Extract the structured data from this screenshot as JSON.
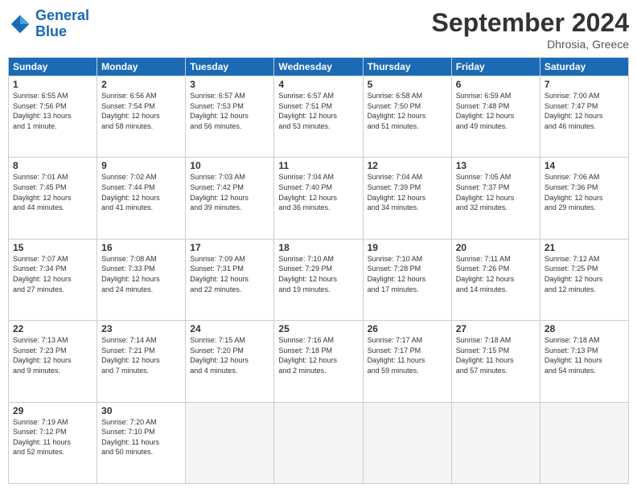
{
  "header": {
    "logo_line1": "General",
    "logo_line2": "Blue",
    "title": "September 2024",
    "location": "Dhrosia, Greece"
  },
  "weekdays": [
    "Sunday",
    "Monday",
    "Tuesday",
    "Wednesday",
    "Thursday",
    "Friday",
    "Saturday"
  ],
  "weeks": [
    [
      {
        "day": "1",
        "info": "Sunrise: 6:55 AM\nSunset: 7:56 PM\nDaylight: 13 hours\nand 1 minute."
      },
      {
        "day": "2",
        "info": "Sunrise: 6:56 AM\nSunset: 7:54 PM\nDaylight: 12 hours\nand 58 minutes."
      },
      {
        "day": "3",
        "info": "Sunrise: 6:57 AM\nSunset: 7:53 PM\nDaylight: 12 hours\nand 56 minutes."
      },
      {
        "day": "4",
        "info": "Sunrise: 6:57 AM\nSunset: 7:51 PM\nDaylight: 12 hours\nand 53 minutes."
      },
      {
        "day": "5",
        "info": "Sunrise: 6:58 AM\nSunset: 7:50 PM\nDaylight: 12 hours\nand 51 minutes."
      },
      {
        "day": "6",
        "info": "Sunrise: 6:59 AM\nSunset: 7:48 PM\nDaylight: 12 hours\nand 49 minutes."
      },
      {
        "day": "7",
        "info": "Sunrise: 7:00 AM\nSunset: 7:47 PM\nDaylight: 12 hours\nand 46 minutes."
      }
    ],
    [
      {
        "day": "8",
        "info": "Sunrise: 7:01 AM\nSunset: 7:45 PM\nDaylight: 12 hours\nand 44 minutes."
      },
      {
        "day": "9",
        "info": "Sunrise: 7:02 AM\nSunset: 7:44 PM\nDaylight: 12 hours\nand 41 minutes."
      },
      {
        "day": "10",
        "info": "Sunrise: 7:03 AM\nSunset: 7:42 PM\nDaylight: 12 hours\nand 39 minutes."
      },
      {
        "day": "11",
        "info": "Sunrise: 7:04 AM\nSunset: 7:40 PM\nDaylight: 12 hours\nand 36 minutes."
      },
      {
        "day": "12",
        "info": "Sunrise: 7:04 AM\nSunset: 7:39 PM\nDaylight: 12 hours\nand 34 minutes."
      },
      {
        "day": "13",
        "info": "Sunrise: 7:05 AM\nSunset: 7:37 PM\nDaylight: 12 hours\nand 32 minutes."
      },
      {
        "day": "14",
        "info": "Sunrise: 7:06 AM\nSunset: 7:36 PM\nDaylight: 12 hours\nand 29 minutes."
      }
    ],
    [
      {
        "day": "15",
        "info": "Sunrise: 7:07 AM\nSunset: 7:34 PM\nDaylight: 12 hours\nand 27 minutes."
      },
      {
        "day": "16",
        "info": "Sunrise: 7:08 AM\nSunset: 7:33 PM\nDaylight: 12 hours\nand 24 minutes."
      },
      {
        "day": "17",
        "info": "Sunrise: 7:09 AM\nSunset: 7:31 PM\nDaylight: 12 hours\nand 22 minutes."
      },
      {
        "day": "18",
        "info": "Sunrise: 7:10 AM\nSunset: 7:29 PM\nDaylight: 12 hours\nand 19 minutes."
      },
      {
        "day": "19",
        "info": "Sunrise: 7:10 AM\nSunset: 7:28 PM\nDaylight: 12 hours\nand 17 minutes."
      },
      {
        "day": "20",
        "info": "Sunrise: 7:11 AM\nSunset: 7:26 PM\nDaylight: 12 hours\nand 14 minutes."
      },
      {
        "day": "21",
        "info": "Sunrise: 7:12 AM\nSunset: 7:25 PM\nDaylight: 12 hours\nand 12 minutes."
      }
    ],
    [
      {
        "day": "22",
        "info": "Sunrise: 7:13 AM\nSunset: 7:23 PM\nDaylight: 12 hours\nand 9 minutes."
      },
      {
        "day": "23",
        "info": "Sunrise: 7:14 AM\nSunset: 7:21 PM\nDaylight: 12 hours\nand 7 minutes."
      },
      {
        "day": "24",
        "info": "Sunrise: 7:15 AM\nSunset: 7:20 PM\nDaylight: 12 hours\nand 4 minutes."
      },
      {
        "day": "25",
        "info": "Sunrise: 7:16 AM\nSunset: 7:18 PM\nDaylight: 12 hours\nand 2 minutes."
      },
      {
        "day": "26",
        "info": "Sunrise: 7:17 AM\nSunset: 7:17 PM\nDaylight: 11 hours\nand 59 minutes."
      },
      {
        "day": "27",
        "info": "Sunrise: 7:18 AM\nSunset: 7:15 PM\nDaylight: 11 hours\nand 57 minutes."
      },
      {
        "day": "28",
        "info": "Sunrise: 7:18 AM\nSunset: 7:13 PM\nDaylight: 11 hours\nand 54 minutes."
      }
    ],
    [
      {
        "day": "29",
        "info": "Sunrise: 7:19 AM\nSunset: 7:12 PM\nDaylight: 11 hours\nand 52 minutes."
      },
      {
        "day": "30",
        "info": "Sunrise: 7:20 AM\nSunset: 7:10 PM\nDaylight: 11 hours\nand 50 minutes."
      },
      {
        "day": "",
        "info": ""
      },
      {
        "day": "",
        "info": ""
      },
      {
        "day": "",
        "info": ""
      },
      {
        "day": "",
        "info": ""
      },
      {
        "day": "",
        "info": ""
      }
    ]
  ]
}
